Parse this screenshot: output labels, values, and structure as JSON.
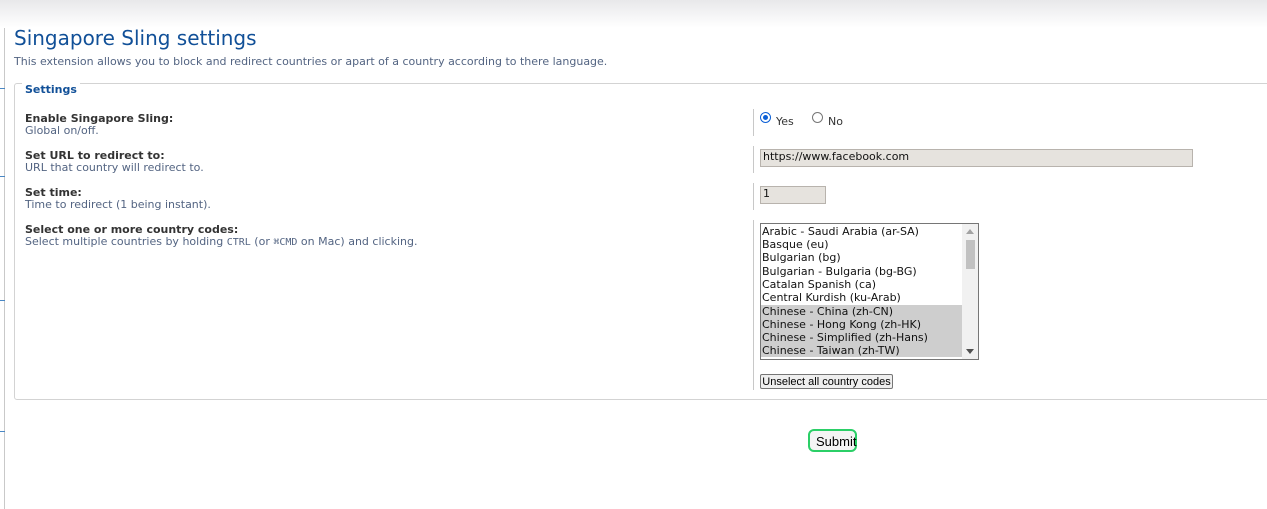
{
  "page": {
    "title": "Singapore Sling settings",
    "description": "This extension allows you to block and redirect countries or apart of a country according to there language."
  },
  "settings": {
    "legend": "Settings",
    "enable": {
      "label": "Enable Singapore Sling:",
      "hint": "Global on/off.",
      "yes_label": "Yes",
      "no_label": "No",
      "selected": "Yes"
    },
    "url": {
      "label": "Set URL to redirect to:",
      "hint": "URL that country will redirect to.",
      "value": "https://www.facebook.com"
    },
    "time": {
      "label": "Set time:",
      "hint": "Time to redirect (1 being instant).",
      "value": "1"
    },
    "countries": {
      "label": "Select one or more country codes:",
      "hint_prefix": "Select multiple countries by holding ",
      "hint_ctrl": "CTRL",
      "hint_middle": " (or ",
      "hint_cmd": "⌘CMD",
      "hint_suffix": " on Mac) and clicking.",
      "options": [
        {
          "label": "Arabic - Saudi Arabia (ar-SA)",
          "selected": false
        },
        {
          "label": "Basque (eu)",
          "selected": false
        },
        {
          "label": "Bulgarian (bg)",
          "selected": false
        },
        {
          "label": "Bulgarian - Bulgaria (bg-BG)",
          "selected": false
        },
        {
          "label": "Catalan Spanish (ca)",
          "selected": false
        },
        {
          "label": "Central Kurdish (ku-Arab)",
          "selected": false
        },
        {
          "label": "Chinese - China (zh-CN)",
          "selected": true
        },
        {
          "label": "Chinese - Hong Kong (zh-HK)",
          "selected": true
        },
        {
          "label": "Chinese - Simplified (zh-Hans)",
          "selected": true
        },
        {
          "label": "Chinese - Taiwan (zh-TW)",
          "selected": true
        }
      ],
      "unselect_label": "Unselect all country codes"
    }
  },
  "submit_label": "Submit",
  "colors": {
    "title": "#115098",
    "hint": "#536482",
    "selected_option": "#cecece",
    "submit_focus": "#2bcf67"
  }
}
